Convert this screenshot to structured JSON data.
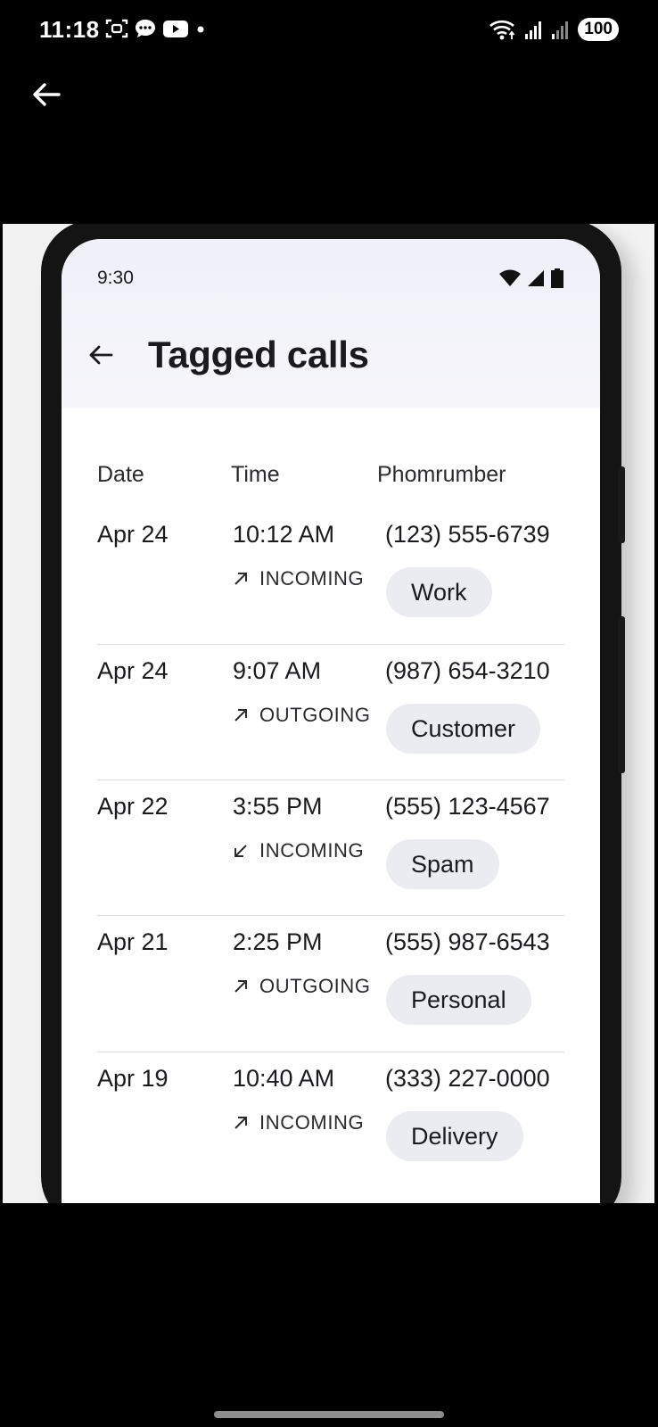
{
  "device_status": {
    "time": "11:18",
    "battery": "100",
    "left_icons": [
      "screenshot-icon",
      "message-icon",
      "youtube-icon",
      "dot-icon"
    ],
    "right_icons": [
      "wifi-icon",
      "signal-icon",
      "signal-icon"
    ]
  },
  "phone": {
    "status_time": "9:30",
    "title": "Tagged calls",
    "columns": [
      "Date",
      "Time",
      "Phomrumber"
    ],
    "calls": [
      {
        "date": "Apr 24",
        "time": "10:12 AM",
        "direction": "INCOMING",
        "arrow": "arrow-up-right-icon",
        "phone": "(123) 555-6739",
        "tag": "Work"
      },
      {
        "date": "Apr 24",
        "time": "9:07 AM",
        "direction": "OUTGOING",
        "arrow": "arrow-up-right-icon",
        "phone": "(987) 654-3210",
        "tag": "Customer"
      },
      {
        "date": "Apr 22",
        "time": "3:55 PM",
        "direction": "INCOMING",
        "arrow": "arrow-down-left-icon",
        "phone": "(555) 123-4567",
        "tag": "Spam"
      },
      {
        "date": "Apr 21",
        "time": "2:25 PM",
        "direction": "OUTGOING",
        "arrow": "arrow-up-right-icon",
        "phone": "(555) 987-6543",
        "tag": "Personal"
      },
      {
        "date": "Apr 19",
        "time": "10:40 AM",
        "direction": "INCOMING",
        "arrow": "arrow-up-right-icon",
        "phone": "(333) 227-0000",
        "tag": "Delivery"
      }
    ]
  },
  "colors": {
    "background": "#000000",
    "screen": "#ffffff",
    "header_tint": "#eff0f8",
    "chip": "#ebecf2",
    "text": "#1b1b1f"
  }
}
